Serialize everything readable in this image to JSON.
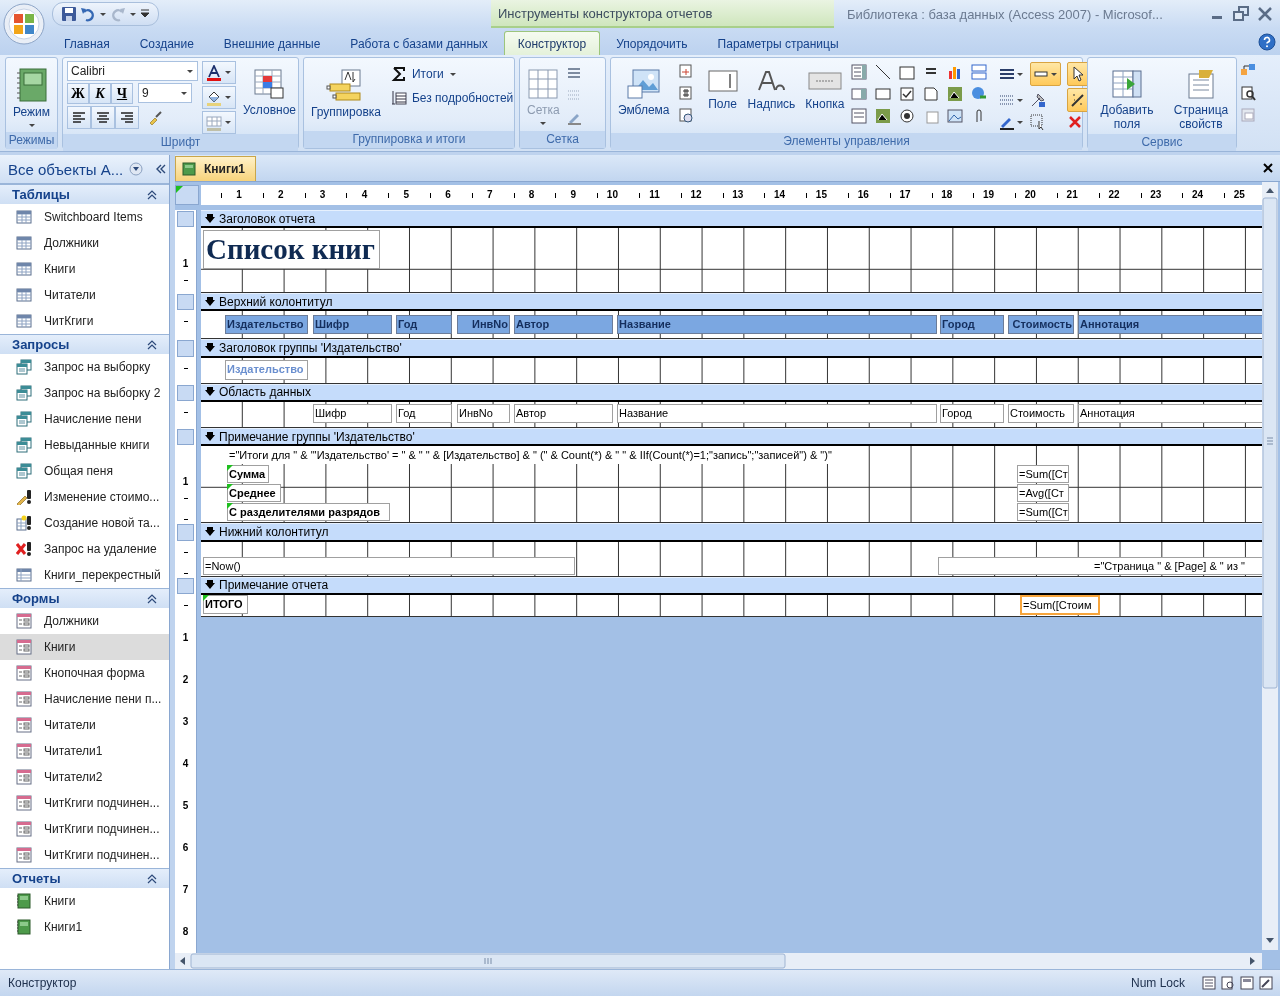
{
  "window": {
    "context_tab": "Инструменты конструктора отчетов",
    "title": "Библиотека : база данных (Access 2007)  -  Microsof..."
  },
  "ribbon_tabs": [
    {
      "label": "Главная",
      "selected": false
    },
    {
      "label": "Создание",
      "selected": false
    },
    {
      "label": "Внешние данные",
      "selected": false
    },
    {
      "label": "Работа с базами данных",
      "selected": false
    },
    {
      "label": "Конструктор",
      "selected": true
    },
    {
      "label": "Упорядочить",
      "selected": false
    },
    {
      "label": "Параметры страницы",
      "selected": false
    }
  ],
  "ribbon_groups": [
    {
      "label": "Режимы",
      "kind": "views",
      "buttons": [
        {
          "label": "Режим",
          "disabled": false
        }
      ]
    },
    {
      "label": "Шрифт",
      "kind": "font",
      "font_name": "Calibri",
      "font_size": "9",
      "format_buttons": [
        "Ж",
        "К",
        "Ч"
      ],
      "buttons": [
        {
          "label": "Условное",
          "disabled": false
        }
      ]
    },
    {
      "label": "Группировка и итоги",
      "kind": "grouping",
      "buttons": [
        {
          "label": "Группировка",
          "disabled": false
        },
        {
          "label": "Итоги",
          "disabled": false
        },
        {
          "label": "Без подробностей",
          "disabled": false
        }
      ]
    },
    {
      "label": "Сетка",
      "kind": "grid",
      "buttons": [
        {
          "label": "Сетка",
          "disabled": true
        }
      ]
    },
    {
      "label": "Элементы управления",
      "kind": "controls",
      "buttons": [
        {
          "label": "Эмблема",
          "disabled": false
        },
        {
          "label": "Поле",
          "disabled": false
        },
        {
          "label": "Надпись",
          "disabled": false
        },
        {
          "label": "Кнопка",
          "disabled": false
        }
      ],
      "toggles": [
        {
          "on": true
        },
        {
          "on": true
        },
        {
          "on": true
        }
      ]
    },
    {
      "label": "Сервис",
      "kind": "tools",
      "buttons": [
        {
          "label": "Добавить поля",
          "disabled": false
        },
        {
          "label": "Страница свойств",
          "disabled": false
        }
      ]
    }
  ],
  "nav": {
    "title": "Все объекты A...",
    "groups": [
      {
        "title": "Таблицы",
        "items": [
          {
            "label": "Switchboard Items",
            "kind": "table",
            "selected": false
          },
          {
            "label": "Должники",
            "kind": "table",
            "selected": false
          },
          {
            "label": "Книги",
            "kind": "table",
            "selected": false
          },
          {
            "label": "Читатели",
            "kind": "table",
            "selected": false
          },
          {
            "label": "ЧитКгиги",
            "kind": "table",
            "selected": false
          }
        ]
      },
      {
        "title": "Запросы",
        "items": [
          {
            "label": "Запрос на выборку",
            "kind": "select-query",
            "selected": false
          },
          {
            "label": "Запрос на выборку 2",
            "kind": "select-query",
            "selected": false
          },
          {
            "label": "Начисление пени",
            "kind": "select-query",
            "selected": false
          },
          {
            "label": "Невыданные книги",
            "kind": "select-query",
            "selected": false
          },
          {
            "label": "Общая пеня",
            "kind": "select-query",
            "selected": false
          },
          {
            "label": "Изменение стоимо...",
            "kind": "update-query",
            "selected": false
          },
          {
            "label": "Создание новой та...",
            "kind": "make-table-query",
            "selected": false
          },
          {
            "label": "Запрос на удаление",
            "kind": "delete-query",
            "selected": false
          },
          {
            "label": "Книги_перекрестный",
            "kind": "crosstab-query",
            "selected": false
          }
        ]
      },
      {
        "title": "Формы",
        "items": [
          {
            "label": "Должники",
            "kind": "form",
            "selected": false
          },
          {
            "label": "Книги",
            "kind": "form",
            "selected": true
          },
          {
            "label": "Кнопочная форма",
            "kind": "form",
            "selected": false
          },
          {
            "label": "Начисление пени п...",
            "kind": "form",
            "selected": false
          },
          {
            "label": "Читатели",
            "kind": "form",
            "selected": false
          },
          {
            "label": "Читатели1",
            "kind": "form",
            "selected": false
          },
          {
            "label": "Читатели2",
            "kind": "form",
            "selected": false
          },
          {
            "label": "ЧитКгиги подчинен...",
            "kind": "form",
            "selected": false
          },
          {
            "label": "ЧитКгиги подчинен...",
            "kind": "form",
            "selected": false
          },
          {
            "label": "ЧитКгиги подчинен...",
            "kind": "form",
            "selected": false
          }
        ]
      },
      {
        "title": "Отчеты",
        "items": [
          {
            "label": "Книги",
            "kind": "report",
            "selected": false
          },
          {
            "label": "Книги1",
            "kind": "report",
            "selected": false
          }
        ]
      }
    ]
  },
  "designer": {
    "tab": "Книги1",
    "ruler": [
      "1",
      "2",
      "3",
      "4",
      "5",
      "6",
      "7",
      "8",
      "9",
      "10",
      "11",
      "12",
      "13",
      "14",
      "15",
      "16",
      "17",
      "18",
      "19",
      "20",
      "21",
      "22",
      "23",
      "24",
      "25"
    ],
    "sections": [
      {
        "title": "Заголовок отчета",
        "ruler_marks": [
          "1"
        ],
        "controls": [
          {
            "kind": "title",
            "text": "Список книг",
            "selected": false,
            "flagged": false
          }
        ]
      },
      {
        "title": "Верхний колонтитул",
        "controls": [
          {
            "kind": "header-label",
            "text": "Издательство",
            "selected": false,
            "flagged": false
          },
          {
            "kind": "header-label",
            "text": "Шифр",
            "selected": false,
            "flagged": false
          },
          {
            "kind": "header-label",
            "text": "Год",
            "selected": false,
            "flagged": false
          },
          {
            "kind": "header-label",
            "text": "ИнвNo",
            "selected": false,
            "flagged": false
          },
          {
            "kind": "header-label",
            "text": "Автор",
            "selected": false,
            "flagged": false
          },
          {
            "kind": "header-label",
            "text": "Название",
            "selected": false,
            "flagged": false
          },
          {
            "kind": "header-label",
            "text": "Город",
            "selected": false,
            "flagged": false
          },
          {
            "kind": "header-label",
            "text": "Стоимость",
            "selected": false,
            "flagged": false
          },
          {
            "kind": "header-label",
            "text": "Аннотация",
            "selected": false,
            "flagged": false
          }
        ]
      },
      {
        "title": "Заголовок группы 'Издательство'",
        "controls": [
          {
            "kind": "group-field",
            "text": "Издательство",
            "selected": false,
            "flagged": false
          }
        ]
      },
      {
        "title": "Область данных",
        "controls": [
          {
            "kind": "field",
            "text": "Шифр",
            "selected": false,
            "flagged": false
          },
          {
            "kind": "field",
            "text": "Год",
            "selected": false,
            "flagged": false
          },
          {
            "kind": "field",
            "text": "ИнвNo",
            "selected": false,
            "flagged": false
          },
          {
            "kind": "field",
            "text": "Автор",
            "selected": false,
            "flagged": false
          },
          {
            "kind": "field",
            "text": "Название",
            "selected": false,
            "flagged": false
          },
          {
            "kind": "field",
            "text": "Город",
            "selected": false,
            "flagged": false
          },
          {
            "kind": "field",
            "text": "Стоимость",
            "selected": false,
            "flagged": false
          },
          {
            "kind": "field",
            "text": "Аннотация",
            "selected": false,
            "flagged": false
          }
        ]
      },
      {
        "title": "Примечание группы 'Издательство'",
        "ruler_marks": [
          "1"
        ],
        "controls": [
          {
            "kind": "field",
            "text": "=\"Итоги для \" & \"'Издательство' = \" & \" \" & [Издательство] & \" (\" & Count(*) & \" \" & IIf(Count(*)=1;\"запись\";\"записей\") & \")\"",
            "selected": false,
            "flagged": false
          },
          {
            "kind": "bold-label",
            "text": "Сумма",
            "selected": false,
            "flagged": true
          },
          {
            "kind": "bold-label",
            "text": "Среднее",
            "selected": false,
            "flagged": true
          },
          {
            "kind": "bold-label",
            "text": "С разделителями разрядов",
            "selected": false,
            "flagged": true
          },
          {
            "kind": "field",
            "text": "=Sum([Ст",
            "selected": false,
            "flagged": false
          },
          {
            "kind": "field",
            "text": "=Avg([Ст",
            "selected": false,
            "flagged": false
          },
          {
            "kind": "field",
            "text": "=Sum([Ст",
            "selected": false,
            "flagged": false
          }
        ]
      },
      {
        "title": "Нижний колонтитул",
        "controls": [
          {
            "kind": "field",
            "text": "=Now()",
            "selected": false,
            "flagged": false
          },
          {
            "kind": "field",
            "text": "=\"Страница \" & [Page] & \" из \"",
            "selected": false,
            "flagged": false
          }
        ]
      },
      {
        "title": "Примечание отчета",
        "controls": [
          {
            "kind": "bold-label",
            "text": "ИТОГО",
            "selected": false,
            "flagged": true
          },
          {
            "kind": "field",
            "text": "=Sum([Стоим",
            "selected": true,
            "flagged": false
          }
        ]
      }
    ],
    "lower_ruler": [
      "1",
      "2",
      "3",
      "4",
      "5",
      "6",
      "7",
      "8"
    ]
  },
  "status_bar": {
    "text": "Конструктор",
    "indicator": "Num Lock"
  }
}
